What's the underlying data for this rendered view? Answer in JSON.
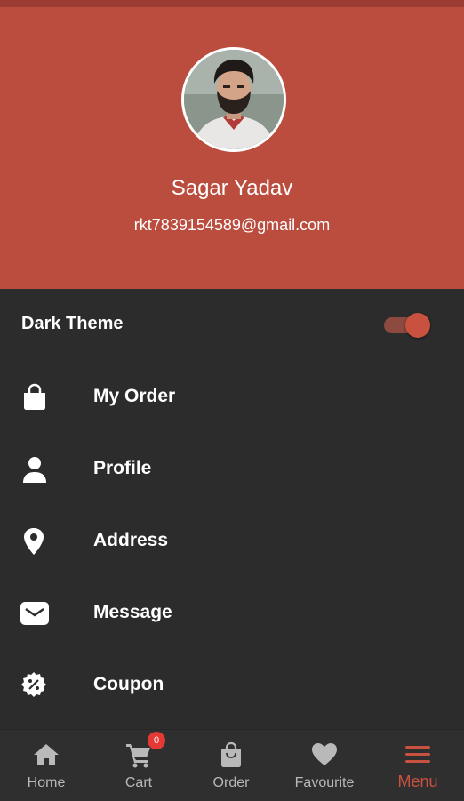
{
  "colors": {
    "header_bg": "#bb4d3f",
    "menu_bg": "#2c2c2c",
    "nav_bg": "#2f2f2f",
    "accent": "#c9513f",
    "badge": "#e53935"
  },
  "profile": {
    "name": "Sagar Yadav",
    "email": "rkt7839154589@gmail.com"
  },
  "theme": {
    "label": "Dark Theme",
    "enabled": true
  },
  "menu": {
    "items": [
      {
        "label": "My Order",
        "icon": "shopping-bag-icon"
      },
      {
        "label": "Profile",
        "icon": "person-icon"
      },
      {
        "label": "Address",
        "icon": "location-pin-icon"
      },
      {
        "label": "Message",
        "icon": "envelope-icon"
      },
      {
        "label": "Coupon",
        "icon": "coupon-icon"
      }
    ]
  },
  "nav": {
    "items": [
      {
        "label": "Home",
        "icon": "home-icon"
      },
      {
        "label": "Cart",
        "icon": "cart-icon",
        "badge": "0"
      },
      {
        "label": "Order",
        "icon": "bag-icon"
      },
      {
        "label": "Favourite",
        "icon": "heart-icon"
      },
      {
        "label": "Menu",
        "icon": "menu-icon",
        "active": true
      }
    ]
  }
}
